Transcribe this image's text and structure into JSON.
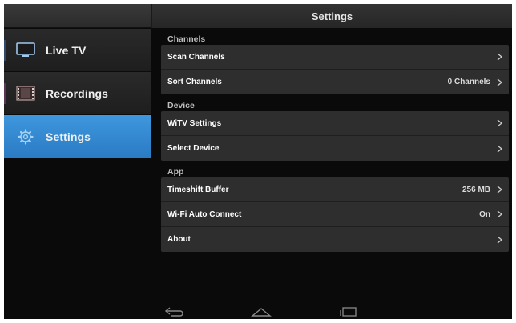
{
  "header": {
    "title": "Settings"
  },
  "sidebar": {
    "items": [
      {
        "label": "Live TV",
        "icon": "tv-icon"
      },
      {
        "label": "Recordings",
        "icon": "film-icon"
      },
      {
        "label": "Settings",
        "icon": "gear-icon",
        "active": true
      }
    ]
  },
  "main": {
    "sections": [
      {
        "title": "Channels",
        "rows": [
          {
            "label": "Scan Channels",
            "value": ""
          },
          {
            "label": "Sort Channels",
            "value": "0 Channels"
          }
        ]
      },
      {
        "title": "Device",
        "rows": [
          {
            "label": "WiTV Settings",
            "value": ""
          },
          {
            "label": "Select Device",
            "value": ""
          }
        ]
      },
      {
        "title": "App",
        "rows": [
          {
            "label": "Timeshift Buffer",
            "value": "256 MB"
          },
          {
            "label": "Wi-Fi Auto Connect",
            "value": "On"
          },
          {
            "label": "About",
            "value": ""
          }
        ]
      }
    ]
  },
  "navbar": {
    "buttons": [
      "back-icon",
      "home-icon",
      "recents-icon"
    ]
  },
  "colors": {
    "accent": "#3a8fd6",
    "background": "#0a0a0a",
    "row": "#2e2e2e"
  }
}
